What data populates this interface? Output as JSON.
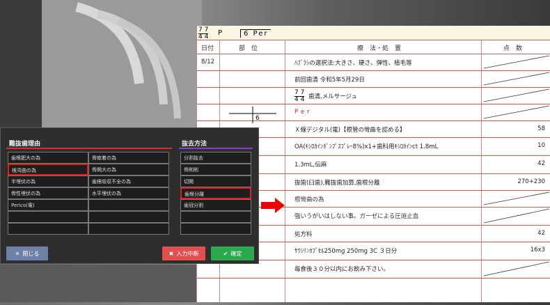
{
  "chart": {
    "tooth_prefix": "P",
    "tooth_code": "6 Per",
    "columns": [
      "日付",
      "部　位",
      "療　法・処　置",
      "点　数"
    ],
    "rows": [
      {
        "date": "8/12",
        "site": "",
        "treatment": "ﾊﾌﾞﾗｼの選択法:大きさ、硬さ、弾性、植毛等",
        "points": ""
      },
      {
        "date": "",
        "site": "",
        "treatment": "前回歯清 令和5年5月29日",
        "points": ""
      },
      {
        "date": "",
        "site": "",
        "treatment": "歯清,メルサージュ",
        "points": ""
      },
      {
        "date": "",
        "site": "",
        "treatment": "Per",
        "points": ""
      },
      {
        "date": "",
        "site": "",
        "treatment": "Ｘ線デジタル(電)【根管の彎曲を認める】",
        "points": "58"
      },
      {
        "date": "",
        "site": "",
        "treatment": "OA(ｷｼﾛｶｲﾝﾎﾟﾝﾌﾟｽﾌﾟﾚｰ8%)x1+歯科用ｷｼﾛｶｲﾝct 1.8mL",
        "points": "10"
      },
      {
        "date": "",
        "site": "",
        "treatment": "1.3mL,伝麻",
        "points": "42"
      },
      {
        "date": "",
        "site": "",
        "treatment": "抜歯(臼歯),難抜歯加算,歯根分離",
        "points": "270+230"
      },
      {
        "date": "",
        "site": "",
        "treatment": "根彎曲の為",
        "points": ""
      },
      {
        "date": "",
        "site": "",
        "treatment": "強いうがいはしない事。ガーゼによる圧迫止血",
        "points": ""
      },
      {
        "date": "",
        "site": "",
        "treatment": "処方料",
        "points": "42"
      },
      {
        "date": "",
        "site": "",
        "treatment": "ｻﾜｼﾘﾝｶﾌﾟｾﾙ250mg 250mg 3C ３日分",
        "points": "16x3"
      },
      {
        "date": "",
        "site": "",
        "treatment": "毎食後３０分以内にお飲み下さい。",
        "points": ""
      }
    ],
    "site_tooth": "6",
    "frac_top": "7 7",
    "frac_bottom": "4 4"
  },
  "dialog": {
    "left_title": "難抜歯理由",
    "right_title": "抜去方法",
    "reasons": [
      [
        "歯根肥大の為",
        "骨癒着の為"
      ],
      [
        "根湾曲の為",
        "骨開大の為"
      ],
      [
        "半埋伏の為",
        "歯根吸収不全の為"
      ],
      [
        "骨性埋伏の為",
        "水平埋伏の為"
      ],
      [
        "Perico(電)",
        ""
      ],
      [
        "",
        ""
      ],
      [
        "",
        ""
      ]
    ],
    "methods": [
      "分割抜去",
      "骨削削",
      "切開",
      "歯根分離",
      "歯冠分割",
      "",
      ""
    ],
    "close_label": "閉じる",
    "abort_label": "入力中断",
    "confirm_label": "確定"
  },
  "colors": {
    "accent_red": "#d22",
    "confirm_green": "#2ea84e",
    "abort_red": "#e05050",
    "close_blue": "#6f7fa6"
  }
}
